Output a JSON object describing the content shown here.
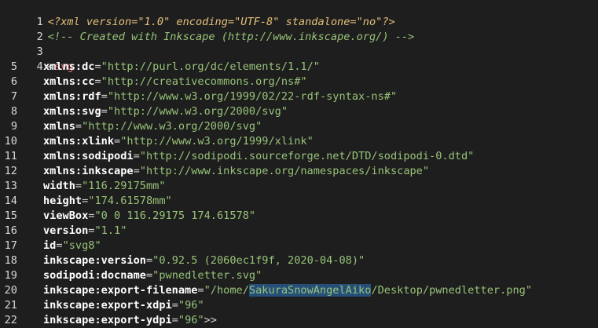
{
  "editor": {
    "line_numbers": [
      "1",
      "2",
      "3",
      "4",
      "5",
      "6",
      "7",
      "8",
      "9",
      "10",
      "11",
      "12",
      "13",
      "14",
      "15",
      "16",
      "17",
      "18",
      "19",
      "20",
      "21",
      "22"
    ],
    "xml_decl": "<?xml version=\"1.0\" encoding=\"UTF-8\" standalone=\"no\"?>",
    "comment": "<!-- Created with Inkscape (http://www.inkscape.org/) -->",
    "open_bracket": "<",
    "tag": "svg",
    "attributes": [
      {
        "name": "xmlns:dc",
        "value": "http://purl.org/dc/elements/1.1/"
      },
      {
        "name": "xmlns:cc",
        "value": "http://creativecommons.org/ns#"
      },
      {
        "name": "xmlns:rdf",
        "value": "http://www.w3.org/1999/02/22-rdf-syntax-ns#"
      },
      {
        "name": "xmlns:svg",
        "value": "http://www.w3.org/2000/svg"
      },
      {
        "name": "xmlns",
        "value": "http://www.w3.org/2000/svg"
      },
      {
        "name": "xmlns:xlink",
        "value": "http://www.w3.org/1999/xlink"
      },
      {
        "name": "xmlns:sodipodi",
        "value": "http://sodipodi.sourceforge.net/DTD/sodipodi-0.dtd"
      },
      {
        "name": "xmlns:inkscape",
        "value": "http://www.inkscape.org/namespaces/inkscape"
      },
      {
        "name": "width",
        "value": "116.29175mm"
      },
      {
        "name": "height",
        "value": "174.61578mm"
      },
      {
        "name": "viewBox",
        "value": "0 0 116.29175 174.61578"
      },
      {
        "name": "version",
        "value": "1.1"
      },
      {
        "name": "id",
        "value": "svg8"
      },
      {
        "name": "inkscape:version",
        "value": "0.92.5 (2060ec1f9f, 2020-04-08)"
      },
      {
        "name": "sodipodi:docname",
        "value": "pwnedletter.svg"
      },
      {
        "name": "inkscape:export-filename",
        "value_prefix": "/home/",
        "value_highlight": "SakuraSnowAngelAiko",
        "value_suffix": "/Desktop/pwnedletter.png"
      },
      {
        "name": "inkscape:export-xdpi",
        "value": "96"
      },
      {
        "name": "inkscape:export-ydpi",
        "value": "96"
      }
    ],
    "close_bracket": ">>",
    "colors": {
      "background": "#1e1e1e",
      "xml_decl": "#e5c07b",
      "comment": "#98c379",
      "tag": "#e06c75",
      "attribute": "#ffffff",
      "value": "#98c379",
      "selection": "#264f78"
    }
  }
}
